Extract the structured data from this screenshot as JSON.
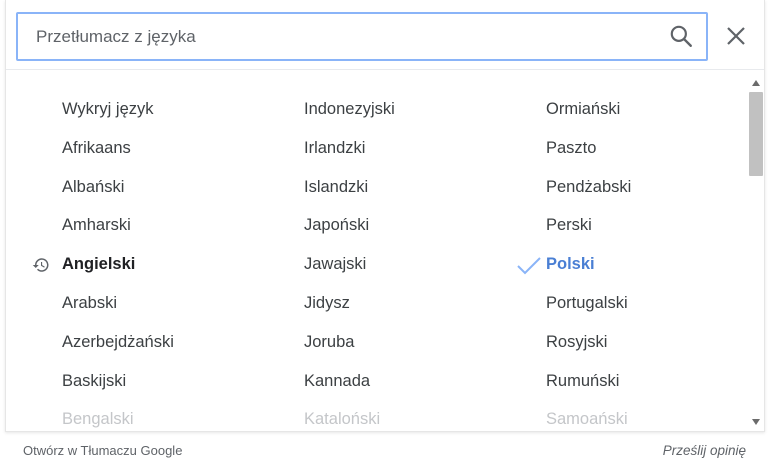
{
  "search": {
    "placeholder": "Przetłumacz z języka",
    "value": ""
  },
  "icons": {
    "search": "search-icon",
    "close": "close-icon",
    "recent": "history-icon",
    "selected": "check-icon"
  },
  "colors": {
    "focus_border": "#8ab4f8",
    "selected_text": "#4a7fd4",
    "faded_text": "#c4c6c9"
  },
  "columns": [
    [
      {
        "label": "Wykryj język"
      },
      {
        "label": "Afrikaans"
      },
      {
        "label": "Albański"
      },
      {
        "label": "Amharski"
      },
      {
        "label": "Angielski",
        "recent": true
      },
      {
        "label": "Arabski"
      },
      {
        "label": "Azerbejdżański"
      },
      {
        "label": "Baskijski"
      },
      {
        "label": "Bengalski",
        "faded": true
      }
    ],
    [
      {
        "label": "Indonezyjski"
      },
      {
        "label": "Irlandzki"
      },
      {
        "label": "Islandzki"
      },
      {
        "label": "Japoński"
      },
      {
        "label": "Jawajski"
      },
      {
        "label": "Jidysz"
      },
      {
        "label": "Joruba"
      },
      {
        "label": "Kannada"
      },
      {
        "label": "Kataloński",
        "faded": true
      }
    ],
    [
      {
        "label": "Ormiański"
      },
      {
        "label": "Paszto"
      },
      {
        "label": "Pendżabski"
      },
      {
        "label": "Perski"
      },
      {
        "label": "Polski",
        "selected": true
      },
      {
        "label": "Portugalski"
      },
      {
        "label": "Rosyjski"
      },
      {
        "label": "Rumuński"
      },
      {
        "label": "Samoański",
        "faded": true
      }
    ]
  ],
  "footer": {
    "open_link": "Otwórz w Tłumaczu Google",
    "feedback_link": "Prześlij opinię"
  }
}
